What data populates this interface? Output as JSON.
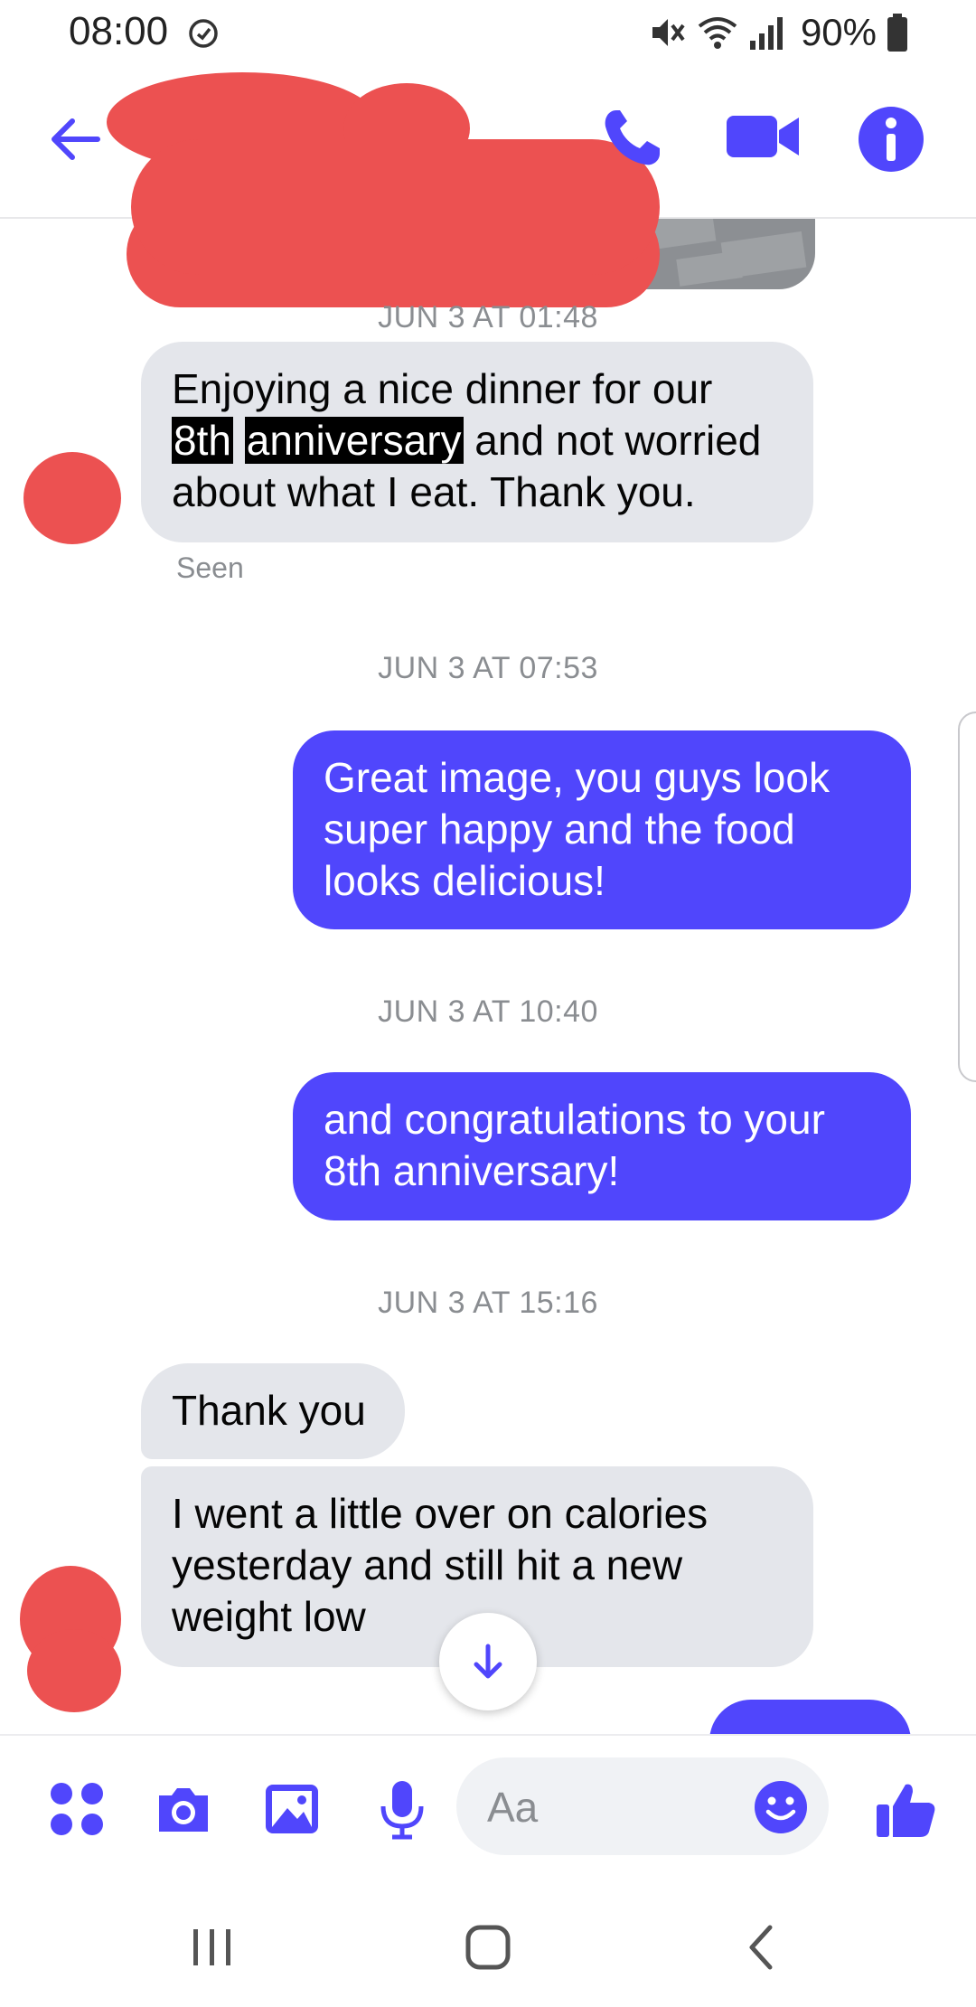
{
  "status_bar": {
    "time": "08:00",
    "battery": "90%",
    "icons": [
      "alarm-icon",
      "mute-icon",
      "wifi-icon",
      "signal-icon",
      "battery-icon"
    ]
  },
  "header": {
    "icons": [
      "back-arrow-icon",
      "phone-icon",
      "video-camera-icon",
      "info-icon"
    ]
  },
  "thread": {
    "messages": [
      {
        "timestamp": "JUN 3 AT 01:48",
        "direction": "incoming",
        "text_before": "Enjoying a nice dinner for our",
        "highlight_1": "8th",
        "highlight_2": "anniversary",
        "text_after": "and not worried about what I eat. Thank you.",
        "status": "Seen"
      },
      {
        "timestamp": "JUN 3 AT 07:53",
        "direction": "outgoing",
        "text": "Great image, you guys look super happy and the food looks delicious!"
      },
      {
        "timestamp": "JUN 3 AT 10:40",
        "direction": "outgoing",
        "text": "and congratulations to your 8th anniversary!"
      },
      {
        "timestamp": "JUN 3 AT 15:16",
        "direction": "incoming",
        "text": "Thank you"
      },
      {
        "direction": "incoming",
        "text": "I went a little over on calories yesterday and still hit a new weight low"
      }
    ]
  },
  "composer": {
    "placeholder": "Aa",
    "icons": [
      "apps-icon",
      "camera-icon",
      "gallery-icon",
      "microphone-icon",
      "emoji-icon",
      "thumbs-up-icon"
    ]
  },
  "nav_bar": {
    "icons": [
      "recent-apps-icon",
      "home-icon",
      "back-icon"
    ]
  },
  "colors": {
    "accent": "#5046fc",
    "incoming_bubble": "#e4e6eb",
    "redaction": "#ec5151",
    "timestamp": "#8a8d91"
  }
}
